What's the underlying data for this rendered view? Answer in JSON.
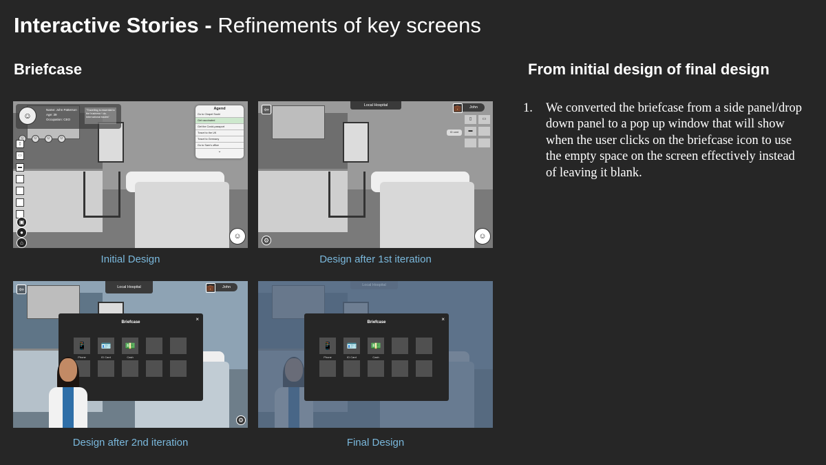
{
  "slide": {
    "title_bold": "Interactive Stories -",
    "title_rest": " Refinements of key screens",
    "left_heading": "Briefcase",
    "right_heading": "From initial design of final design",
    "notes": [
      {
        "num": "1.",
        "text": "We converted the briefcase from a side panel/drop down panel to a pop up window that will show when the user clicks on the briefcase icon to use the empty space on the screen effectively instead of leaving it blank."
      }
    ]
  },
  "screens": {
    "initial": {
      "caption": "Initial Design",
      "profile": {
        "name": "Name: John Patterson",
        "age": "Age: 39",
        "occupation": "Occupation: CEO",
        "quote": "\"Travelling is essential to the business I do. International trades\""
      },
      "agenda": {
        "title": "Agend",
        "items": [
          "Go to Chapel Sushi",
          "Get vaccinated",
          "Get the Covid-passport",
          "Travel to the UK",
          "Travel to Germany",
          "Go to Sam's office"
        ],
        "active_index": 1,
        "more": "⌄"
      }
    },
    "iter1": {
      "caption": "Design after 1st iteration",
      "topbar": "Local Hospital",
      "name": "John",
      "id_label": "ID card"
    },
    "iter2": {
      "caption": "Design after 2nd iteration",
      "topbar": "Local Hospital",
      "name": "John",
      "briefcase_title": "Briefcase",
      "close": "×",
      "items": [
        "Phone",
        "ID Card",
        "Cash"
      ]
    },
    "final": {
      "caption": "Final Design",
      "topbar": "Local Hospital",
      "briefcase_title": "Briefcase",
      "close": "×",
      "items": [
        "Phone",
        "ID Card",
        "Cash"
      ]
    }
  },
  "icons": {
    "phone": "📱",
    "id": "🪪",
    "cash": "💵",
    "exit": "⇦",
    "settings": "⚙",
    "briefcase": "💼",
    "avatar": "☺"
  }
}
